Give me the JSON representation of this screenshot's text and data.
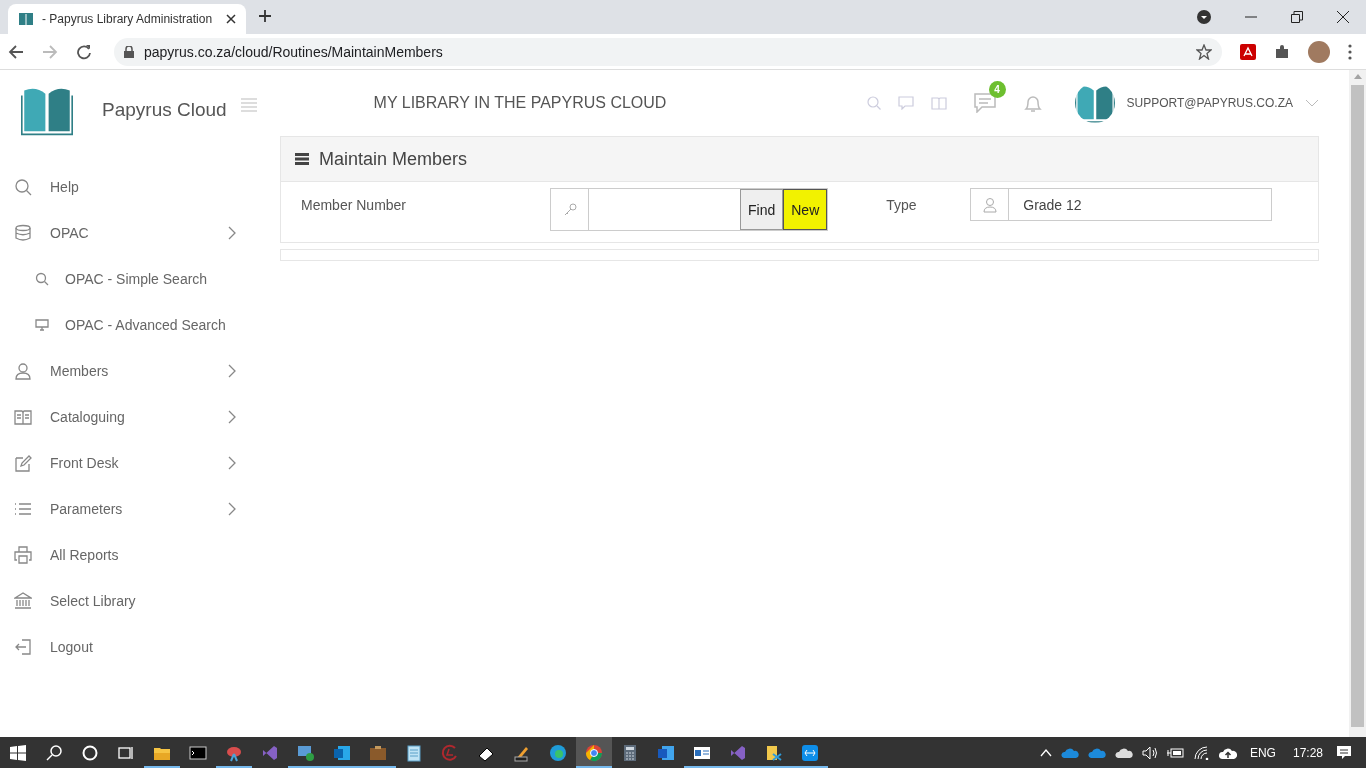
{
  "browser": {
    "tabs": [
      {
        "title": "- Papyrus Library Administration",
        "selected": true
      }
    ],
    "url": "papyrus.co.za/cloud/Routines/MaintainMembers"
  },
  "header": {
    "brand": "Papyrus Cloud",
    "title": "MY LIBRARY IN THE PAPYRUS CLOUD",
    "message_count": "4",
    "user": "SUPPORT@PAPYRUS.CO.ZA"
  },
  "sidebar": {
    "items": [
      {
        "label": "Help",
        "submenu": false
      },
      {
        "label": "OPAC",
        "submenu": true,
        "children": [
          {
            "label": "OPAC - Simple Search"
          },
          {
            "label": "OPAC - Advanced Search"
          }
        ]
      },
      {
        "label": "Members",
        "submenu": true
      },
      {
        "label": "Cataloguing",
        "submenu": true
      },
      {
        "label": "Front Desk",
        "submenu": true
      },
      {
        "label": "Parameters",
        "submenu": true
      },
      {
        "label": "All Reports",
        "submenu": false
      },
      {
        "label": "Select Library",
        "submenu": false
      },
      {
        "label": "Logout",
        "submenu": false
      }
    ]
  },
  "panel": {
    "title": "Maintain Members",
    "member_label": "Member Number",
    "buttons": [
      {
        "label": "Find",
        "highlighted": false
      },
      {
        "label": "New",
        "highlighted": true
      }
    ],
    "type_label": "Type",
    "type_value": "Grade 12"
  },
  "taskbar": {
    "apps": [
      {
        "running": true,
        "active": false
      },
      {
        "running": false,
        "active": false
      },
      {
        "running": true,
        "active": false
      },
      {
        "running": false,
        "active": false
      },
      {
        "running": true,
        "active": false
      },
      {
        "running": true,
        "active": false
      },
      {
        "running": true,
        "active": false
      },
      {
        "running": false,
        "active": false
      },
      {
        "running": false,
        "active": false
      },
      {
        "running": false,
        "active": false
      },
      {
        "running": false,
        "active": false
      },
      {
        "running": false,
        "active": false
      },
      {
        "running": true,
        "active": true
      },
      {
        "running": false,
        "active": false
      },
      {
        "running": false,
        "active": false
      },
      {
        "running": true,
        "active": false
      },
      {
        "running": true,
        "active": false
      },
      {
        "running": true,
        "active": false
      },
      {
        "running": true,
        "active": false
      }
    ],
    "language": "ENG",
    "time": "17:28"
  }
}
